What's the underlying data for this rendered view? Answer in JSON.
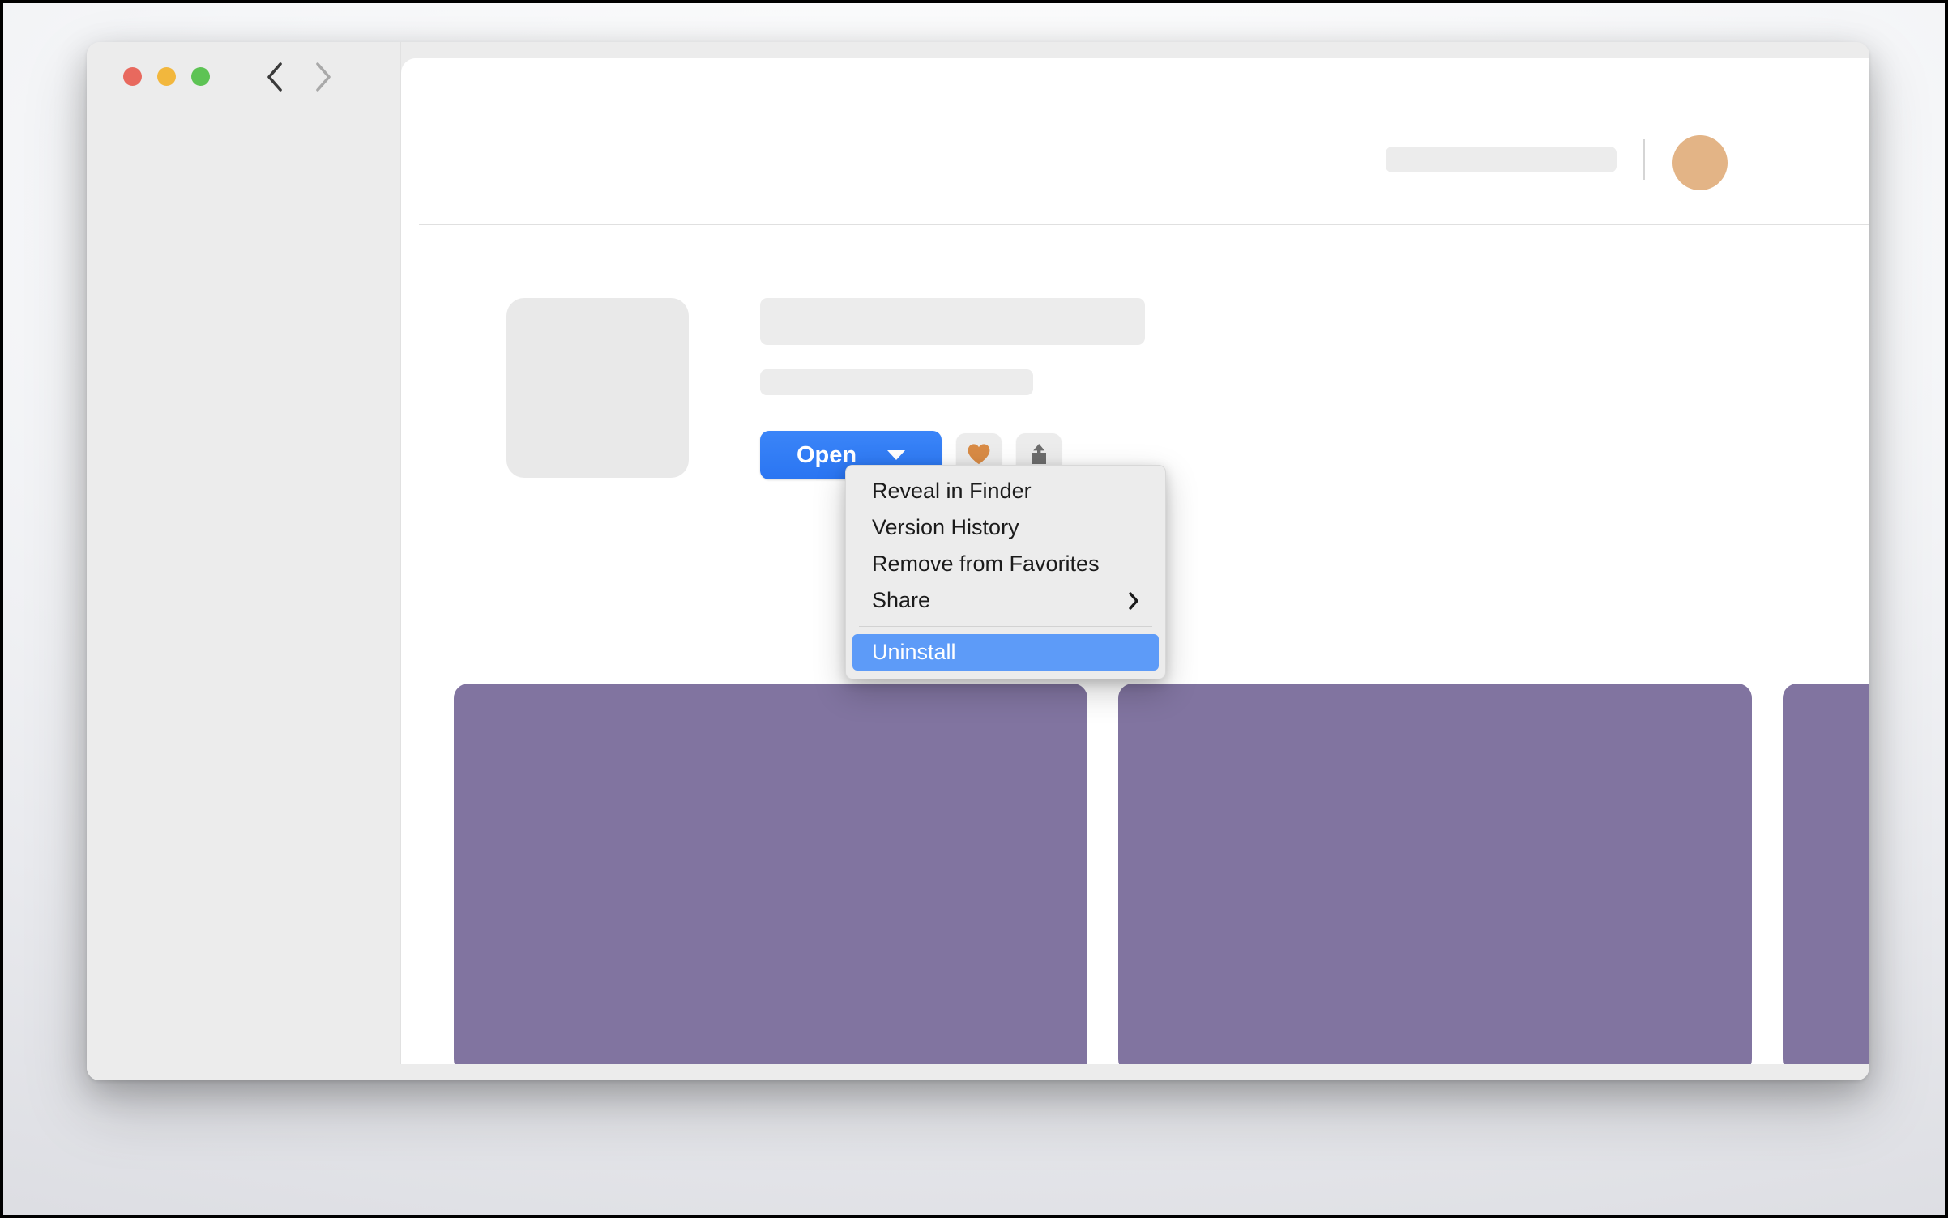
{
  "window": {
    "traffic_lights": [
      {
        "name": "close",
        "color": "#e8695e"
      },
      {
        "name": "minimize",
        "color": "#f2b73d"
      },
      {
        "name": "zoom",
        "color": "#5dc354"
      }
    ],
    "nav": {
      "back_label": "Back",
      "forward_label": "Forward",
      "back_enabled": true,
      "forward_enabled": false
    }
  },
  "header": {
    "search": {
      "placeholder": "",
      "value": ""
    },
    "avatar_color": "#e3b486"
  },
  "app_detail": {
    "title": "",
    "subtitle": "",
    "actions": {
      "open_label": "Open",
      "open_color": "#2f7bf6",
      "favorite_icon": "heart-icon",
      "favorite_color": "#d98b45",
      "share_icon": "share-icon",
      "share_color": "#6d6d6d"
    }
  },
  "dropdown_menu": {
    "visible": true,
    "highlight_color": "#5d9bf8",
    "background_color": "#ececec",
    "items": [
      {
        "label": "Reveal in Finder",
        "highlighted": false,
        "has_submenu": false,
        "separator_after": false
      },
      {
        "label": "Version History",
        "highlighted": false,
        "has_submenu": false,
        "separator_after": false
      },
      {
        "label": "Remove from Favorites",
        "highlighted": false,
        "has_submenu": false,
        "separator_after": false
      },
      {
        "label": "Share",
        "highlighted": false,
        "has_submenu": true,
        "separator_after": true
      },
      {
        "label": "Uninstall",
        "highlighted": true,
        "has_submenu": false,
        "separator_after": false
      }
    ]
  },
  "gallery": {
    "card_color": "#8174a0",
    "cards": [
      {
        "name": "screenshot-1"
      },
      {
        "name": "screenshot-2"
      },
      {
        "name": "screenshot-3"
      }
    ]
  },
  "sidebar": {
    "items": []
  }
}
